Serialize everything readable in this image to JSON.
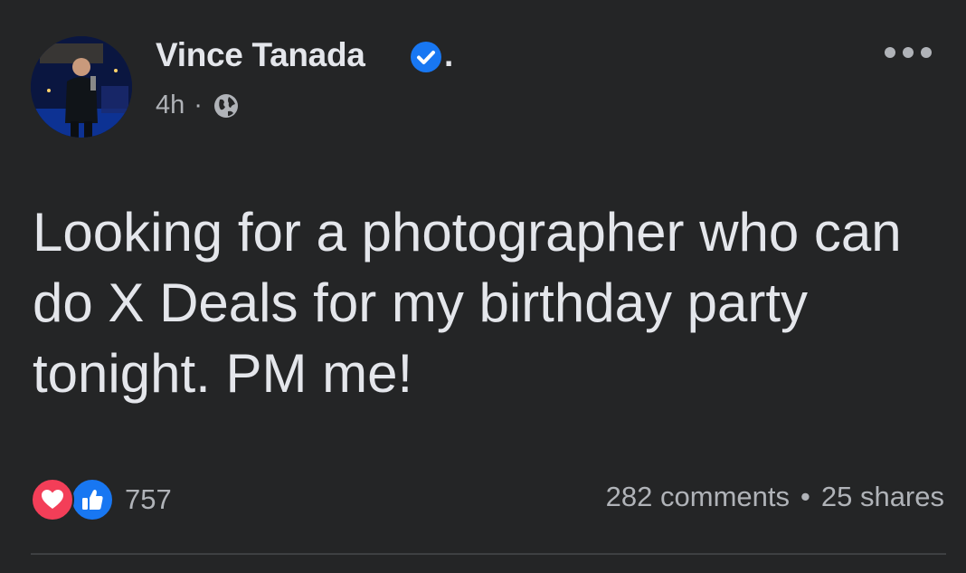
{
  "post": {
    "author": {
      "name": "Vince Tanada",
      "verified": true,
      "trailing_dot": "."
    },
    "time": "4h",
    "separator": "·",
    "privacy_icon": "globe-icon",
    "menu_icon": "more-options-icon",
    "text": "Looking for a photographer who can do X Deals for my birthday party tonight. PM me!",
    "reactions": {
      "icons": [
        "love-reaction-icon",
        "like-reaction-icon"
      ],
      "count": "757"
    },
    "engagement": {
      "comments": "282 comments",
      "bullet": "•",
      "shares": "25 shares"
    }
  },
  "colors": {
    "background": "#242526",
    "primary_text": "#e4e6eb",
    "secondary_text": "#b0b3b8",
    "verified_badge": "#1877f2",
    "love": "#f33e58",
    "like": "#1877f2"
  }
}
